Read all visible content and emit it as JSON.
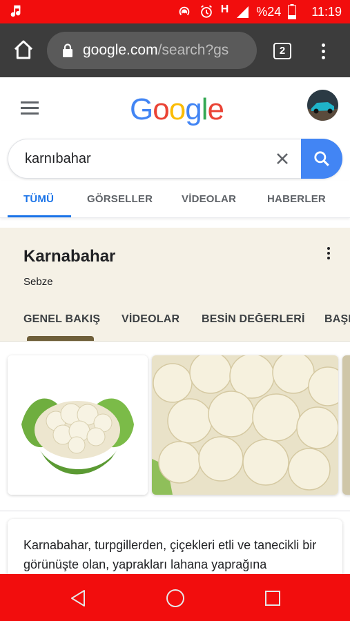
{
  "status_bar": {
    "battery": "%24",
    "network_letter": "H",
    "time": "11:19",
    "icons": [
      "music-note-icon",
      "hotspot-icon",
      "alarm-icon",
      "signal-icon",
      "battery-icon"
    ],
    "color": "#f20d0d"
  },
  "browser": {
    "url_host": "google.com",
    "url_path": "/search?gs",
    "tab_count": "2",
    "icons": [
      "home-icon",
      "lock-icon",
      "overflow-menu-icon"
    ]
  },
  "google": {
    "logo": [
      "G",
      "o",
      "o",
      "g",
      "l",
      "e"
    ],
    "logo_colors": [
      "#4285f4",
      "#ea4335",
      "#fbbc05",
      "#4285f4",
      "#34a853",
      "#ea4335"
    ]
  },
  "search": {
    "query": "karnıbahar"
  },
  "tabs": [
    {
      "label": "TÜMÜ",
      "active": true
    },
    {
      "label": "GÖRSELLER",
      "active": false
    },
    {
      "label": "VİDEOLAR",
      "active": false
    },
    {
      "label": "HABERLER",
      "active": false
    }
  ],
  "knowledge_panel": {
    "title": "Karnabahar",
    "subtitle": "Sebze",
    "tabs": [
      "GENEL BAKIŞ",
      "VİDEOLAR",
      "BESİN DEĞERLERİ",
      "BAŞKA"
    ],
    "description": "Karnabahar, turpgillerden, çiçekleri etli ve tanecikli bir görünüşte olan, yaprakları lahana yaprağına"
  },
  "nav_bar": {
    "icons": [
      "back-icon",
      "home-circle-icon",
      "recents-icon"
    ]
  }
}
